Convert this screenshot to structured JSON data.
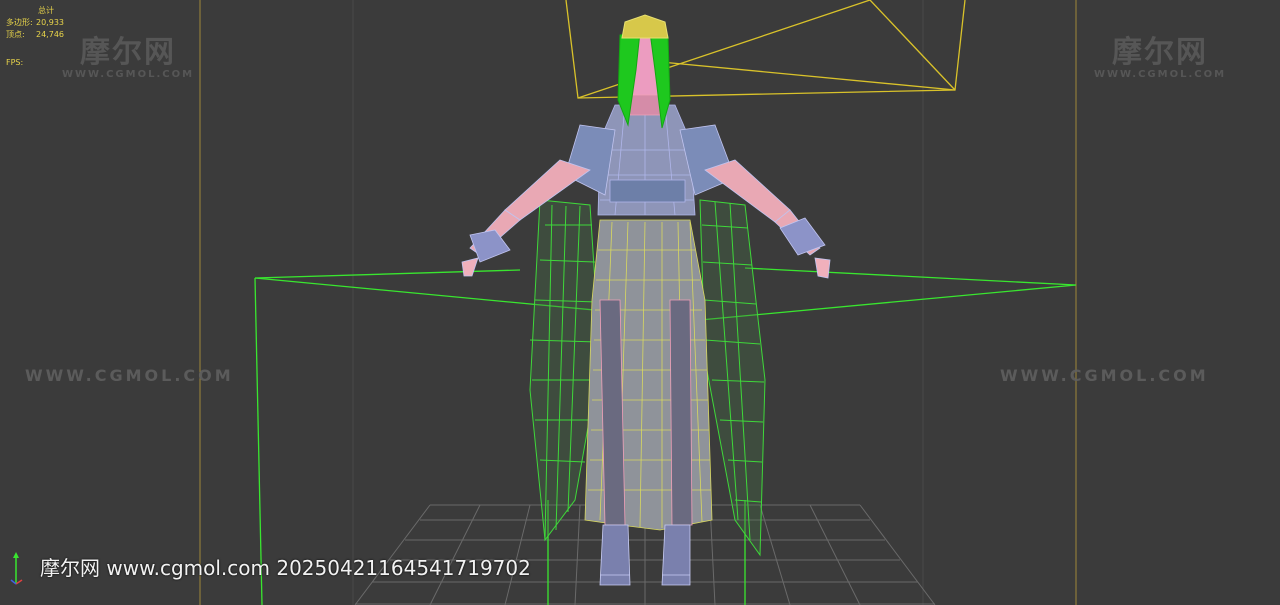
{
  "stats": {
    "header": "总计",
    "polygons_label": "多边形:",
    "polygons_value": "20,933",
    "vertices_label": "顶点:",
    "vertices_value": "24,746",
    "fps_label": "FPS:"
  },
  "watermark": {
    "logo_text": "摩尔网",
    "logo_sub": "WWW.CGMOL.COM",
    "line_text": "WWW.CGMOL.COM"
  },
  "footer": {
    "caption": "摩尔网 www.cgmol.com 20250421164541719702"
  },
  "colors": {
    "viewport_bg": "#3b3b3b",
    "stats_text": "#e8d44a",
    "camera_frame": "#d9c22a",
    "bone_green": "#39e62f",
    "wire_skin": "#f0a0b8",
    "wire_cloth": "#a8b0e8",
    "hair": "#1ec81e"
  },
  "icons": {
    "axis": "axis-tripod-icon"
  }
}
